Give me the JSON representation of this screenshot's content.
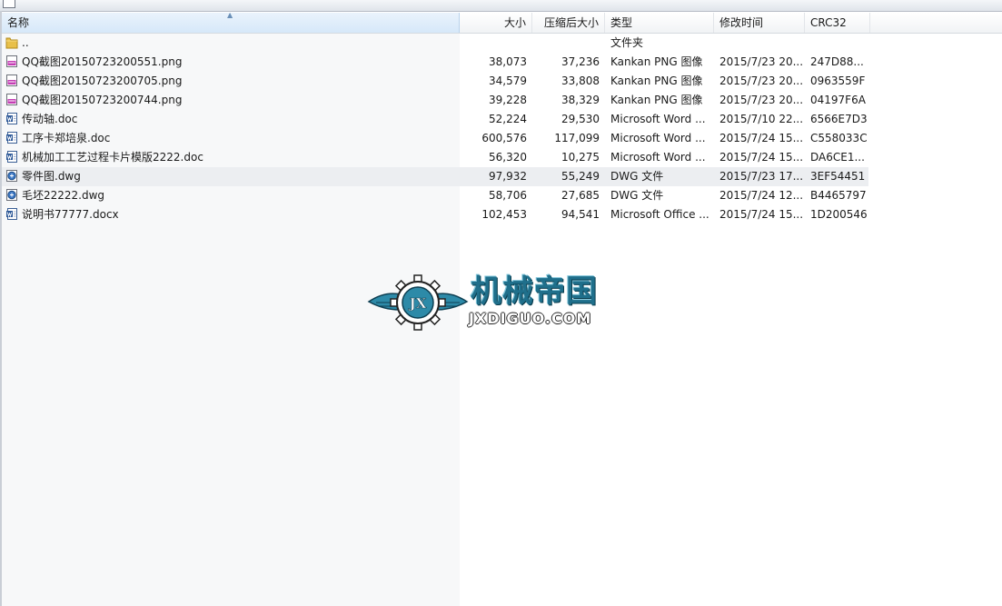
{
  "columns": {
    "name": "名称",
    "size": "大小",
    "packed": "压缩后大小",
    "type": "类型",
    "modified": "修改时间",
    "crc": "CRC32"
  },
  "rows": [
    {
      "icon": "folder-icon",
      "name": "..",
      "size": "",
      "packed": "",
      "type": "文件夹",
      "modified": "",
      "crc": ""
    },
    {
      "icon": "png-file-icon",
      "name": "QQ截图20150723200551.png",
      "size": "38,073",
      "packed": "37,236",
      "type": "Kankan PNG 图像",
      "modified": "2015/7/23 20...",
      "crc": "247D88..."
    },
    {
      "icon": "png-file-icon",
      "name": "QQ截图20150723200705.png",
      "size": "34,579",
      "packed": "33,808",
      "type": "Kankan PNG 图像",
      "modified": "2015/7/23 20...",
      "crc": "0963559F"
    },
    {
      "icon": "png-file-icon",
      "name": "QQ截图20150723200744.png",
      "size": "39,228",
      "packed": "38,329",
      "type": "Kankan PNG 图像",
      "modified": "2015/7/23 20...",
      "crc": "04197F6A"
    },
    {
      "icon": "word-doc-icon",
      "name": "传动轴.doc",
      "size": "52,224",
      "packed": "29,530",
      "type": "Microsoft Word ...",
      "modified": "2015/7/10 22...",
      "crc": "6566E7D3"
    },
    {
      "icon": "word-doc-icon",
      "name": "工序卡郑培泉.doc",
      "size": "600,576",
      "packed": "117,099",
      "type": "Microsoft Word ...",
      "modified": "2015/7/24 15...",
      "crc": "C558033C"
    },
    {
      "icon": "word-doc-icon",
      "name": "机械加工工艺过程卡片模版2222.doc",
      "size": "56,320",
      "packed": "10,275",
      "type": "Microsoft Word ...",
      "modified": "2015/7/24 15...",
      "crc": "DA6CE1..."
    },
    {
      "icon": "dwg-file-icon",
      "name": "零件图.dwg",
      "size": "97,932",
      "packed": "55,249",
      "type": "DWG 文件",
      "modified": "2015/7/23 17...",
      "crc": "3EF54451",
      "highlight": true
    },
    {
      "icon": "dwg-file-icon",
      "name": "毛坯22222.dwg",
      "size": "58,706",
      "packed": "27,685",
      "type": "DWG 文件",
      "modified": "2015/7/24 12...",
      "crc": "B4465797"
    },
    {
      "icon": "word-doc-icon",
      "name": "说明书77777.docx",
      "size": "102,453",
      "packed": "94,541",
      "type": "Microsoft Office ...",
      "modified": "2015/7/24 15...",
      "crc": "1D200546"
    }
  ],
  "watermark": {
    "emblem_letters": "JX",
    "title": "机械帝国",
    "subtitle": "JXDIGUO.COM",
    "color": "#1f6f8b"
  },
  "colors": {
    "sorted_header": "#d6e8f9",
    "highlight_row": "#eceef1",
    "name_column_bg": "#f7f8f9"
  }
}
